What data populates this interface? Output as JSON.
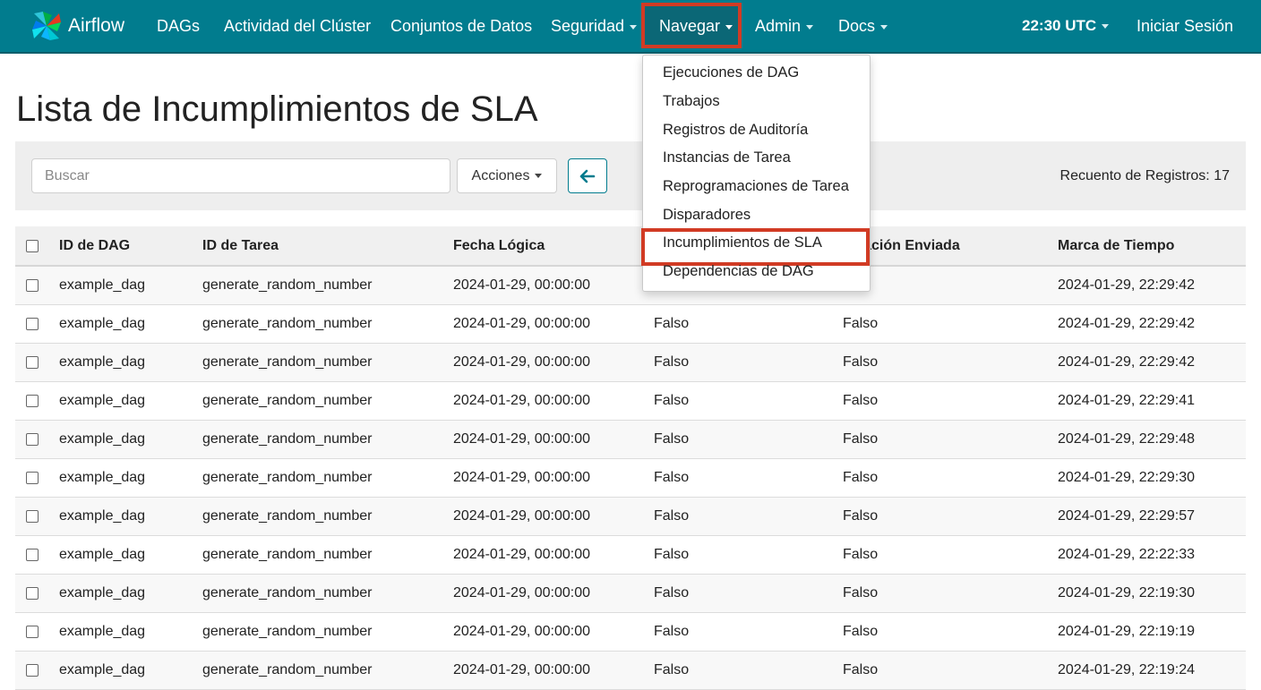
{
  "navbar": {
    "brand": "Airflow",
    "items": [
      {
        "label": "DAGs",
        "dropdown": false
      },
      {
        "label": "Actividad del Clúster",
        "dropdown": false
      },
      {
        "label": "Conjuntos de Datos",
        "dropdown": false
      },
      {
        "label": "Seguridad",
        "dropdown": true
      },
      {
        "label": "Navegar",
        "dropdown": true,
        "active": true
      },
      {
        "label": "Admin",
        "dropdown": true
      },
      {
        "label": "Docs",
        "dropdown": true
      }
    ],
    "time": "22:30 UTC",
    "login": "Iniciar Sesión"
  },
  "browse_menu": {
    "items": [
      "Ejecuciones de DAG",
      "Trabajos",
      "Registros de Auditoría",
      "Instancias de Tarea",
      "Reprogramaciones de Tarea",
      "Disparadores",
      "Incumplimientos de SLA",
      "Dependencias de DAG"
    ],
    "highlighted_index": 6
  },
  "page": {
    "title": "Lista de Incumplimientos de SLA"
  },
  "toolbar": {
    "search_placeholder": "Buscar",
    "actions_label": "Acciones",
    "record_count": "Recuento de Registros: 17"
  },
  "table": {
    "columns": [
      "ID de DAG",
      "ID de Tarea",
      "Fecha Lógica",
      "",
      "ificación Enviada",
      "Marca de Tiempo"
    ],
    "rows": [
      [
        "example_dag",
        "generate_random_number",
        "2024-01-29, 00:00:00",
        "",
        "lso",
        "2024-01-29, 22:29:42"
      ],
      [
        "example_dag",
        "generate_random_number",
        "2024-01-29, 00:00:00",
        "Falso",
        "Falso",
        "2024-01-29, 22:29:42"
      ],
      [
        "example_dag",
        "generate_random_number",
        "2024-01-29, 00:00:00",
        "Falso",
        "Falso",
        "2024-01-29, 22:29:42"
      ],
      [
        "example_dag",
        "generate_random_number",
        "2024-01-29, 00:00:00",
        "Falso",
        "Falso",
        "2024-01-29, 22:29:41"
      ],
      [
        "example_dag",
        "generate_random_number",
        "2024-01-29, 00:00:00",
        "Falso",
        "Falso",
        "2024-01-29, 22:29:48"
      ],
      [
        "example_dag",
        "generate_random_number",
        "2024-01-29, 00:00:00",
        "Falso",
        "Falso",
        "2024-01-29, 22:29:30"
      ],
      [
        "example_dag",
        "generate_random_number",
        "2024-01-29, 00:00:00",
        "Falso",
        "Falso",
        "2024-01-29, 22:29:57"
      ],
      [
        "example_dag",
        "generate_random_number",
        "2024-01-29, 00:00:00",
        "Falso",
        "Falso",
        "2024-01-29, 22:22:33"
      ],
      [
        "example_dag",
        "generate_random_number",
        "2024-01-29, 00:00:00",
        "Falso",
        "Falso",
        "2024-01-29, 22:19:30"
      ],
      [
        "example_dag",
        "generate_random_number",
        "2024-01-29, 00:00:00",
        "Falso",
        "Falso",
        "2024-01-29, 22:19:19"
      ],
      [
        "example_dag",
        "generate_random_number",
        "2024-01-29, 00:00:00",
        "Falso",
        "Falso",
        "2024-01-29, 22:19:24"
      ]
    ]
  },
  "colors": {
    "navbar_bg": "#017c8e",
    "highlight_border": "#d13b24"
  }
}
